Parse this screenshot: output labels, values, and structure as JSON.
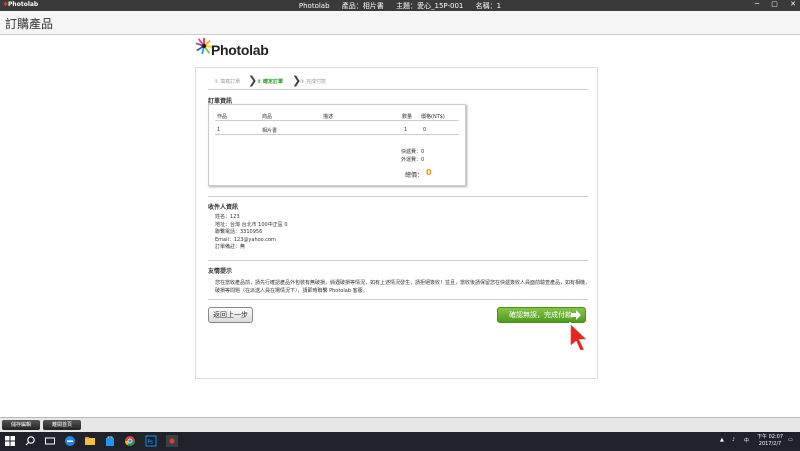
{
  "window": {
    "app_name": "Photolab",
    "title_center_1": "Photolab",
    "title_center_2": "產品：相片書",
    "title_center_3": "主題：愛心_15P-001",
    "title_center_4": "名稱：1"
  },
  "page": {
    "title": "訂購產品"
  },
  "logo": {
    "text": "Photolab"
  },
  "steps": [
    {
      "label": "① 填寫訂單",
      "state": "done"
    },
    {
      "label": "② 確定訂單",
      "state": "active"
    },
    {
      "label": "③ 完成付款",
      "state": "todo"
    }
  ],
  "order": {
    "section_title": "訂單資訊",
    "headers": [
      "作品",
      "商品",
      "描述",
      "數量",
      "價格(NT$)"
    ],
    "row": [
      "1",
      "相片書",
      "",
      "1",
      "0"
    ],
    "shipping_label": "快遞費：0",
    "tax_label": "外運費：0",
    "total_label": "總價：",
    "total_value": "0"
  },
  "recipient": {
    "section_title": "收件人資訊",
    "name": "姓名：123",
    "address": "地址：台灣 台北市 100中正區 0",
    "phone": "聯繫電話：3310956",
    "email": "Email：123@yahoo.com",
    "note": "訂單備註：無"
  },
  "notice": {
    "section_title": "友情提示",
    "text_1": "您在當收產品前，請先行確認產品外包裝有無破損，倘遇破損等情況，如有上述情況發生，請拒絕簽收！並且，當收後請保留您在快遞簽收人員面前驗查產品，如有相機，",
    "text_2": "破損等問題（在派送人員在場情況下），請即時聯繫 Photolab 客服。"
  },
  "buttons": {
    "back": "返回上一步",
    "confirm": "確認無誤，完成付款"
  },
  "bottom_bar": {
    "btn1": "儲存編輯",
    "btn2": "離開首頁"
  },
  "taskbar": {
    "time": "下午 02:07",
    "date": "2017/2/7"
  },
  "colors": {
    "accent_green": "#2c9a2c",
    "total_orange": "#f39200",
    "confirm_green": "#5ea826"
  }
}
